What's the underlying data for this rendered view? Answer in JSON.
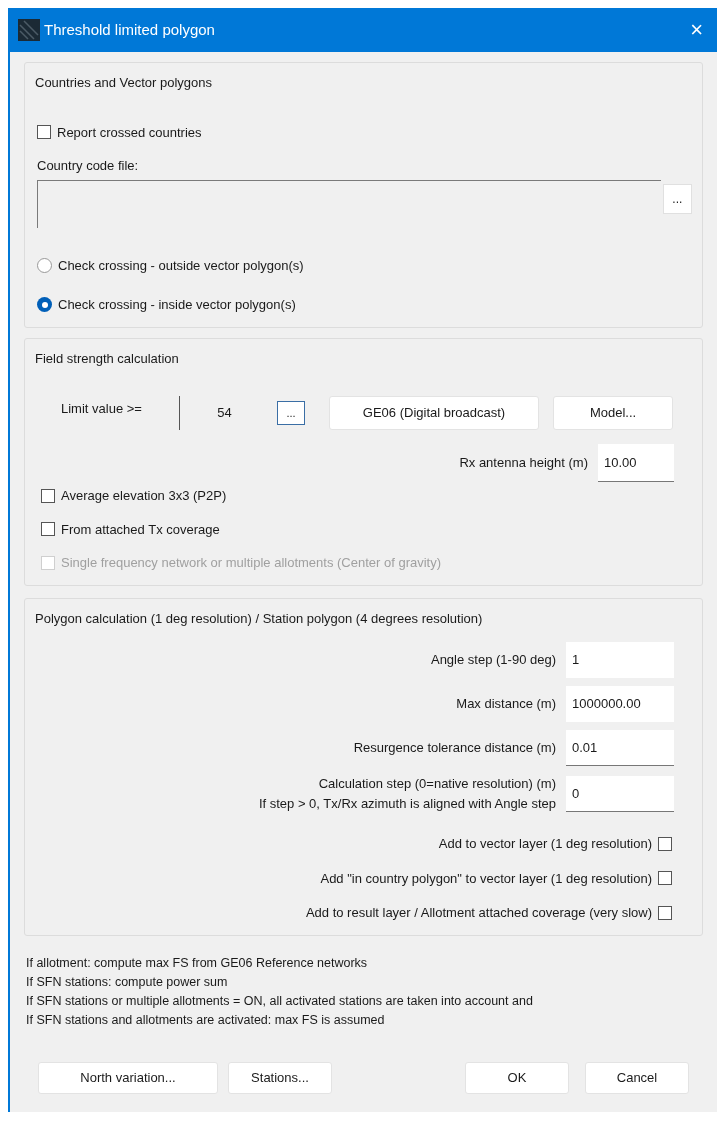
{
  "window": {
    "title": "Threshold limited polygon",
    "close": "×"
  },
  "countries_group": {
    "title": "Countries and Vector polygons",
    "report_checkbox": {
      "label": "Report crossed countries",
      "checked": false
    },
    "country_code_file": {
      "label": "Country code file:",
      "browse": "..."
    },
    "crossing_options": [
      {
        "label": "Check crossing - outside vector polygon(s)",
        "selected": false
      },
      {
        "label": "Check crossing - inside vector polygon(s)",
        "selected": true
      }
    ]
  },
  "field_strength_group": {
    "title": "Field strength calculation",
    "limit_label": "Limit value >=",
    "limit_value": "54",
    "limit_browse": "...",
    "buttons": [
      "GE06 (Digital broadcast)",
      "Model..."
    ],
    "rx_label": "Rx antenna height (m)",
    "rx_value": "10.00",
    "checkboxes": [
      {
        "label": "Average elevation 3x3 (P2P)",
        "checked": false,
        "disabled": false
      },
      {
        "label": "From attached Tx coverage",
        "checked": false,
        "disabled": false
      },
      {
        "label": "Single frequency network or multiple allotments (Center of gravity)",
        "checked": false,
        "disabled": true
      }
    ]
  },
  "polygon_group": {
    "title": "Polygon calculation (1 deg resolution) / Station polygon (4 degrees resolution)",
    "fields": [
      {
        "label": "Angle step (1-90 deg)",
        "value": "1"
      },
      {
        "label": "Max distance (m)",
        "value": "1000000.00"
      },
      {
        "label": "Resurgence tolerance distance (m)",
        "value": "0.01"
      },
      {
        "label": "Calculation step (0=native resolution) (m)",
        "note": "If step > 0, Tx/Rx azimuth is aligned with Angle step",
        "value": "0"
      }
    ],
    "checkboxes": [
      {
        "label": "Add to vector layer (1 deg resolution)",
        "checked": false
      },
      {
        "label": "Add \"in country polygon\" to vector layer (1 deg resolution)",
        "checked": false
      },
      {
        "label": "Add to result layer / Allotment attached coverage (very slow)",
        "checked": false
      }
    ]
  },
  "notes": [
    "If allotment: compute max FS from GE06 Reference networks",
    "If SFN stations: compute power sum",
    "If SFN stations or multiple allotments = ON, all activated stations are taken into account and",
    "If SFN stations and allotments are activated: max FS is assumed"
  ],
  "left_buttons": [
    "North variation...",
    "Stations..."
  ],
  "right_buttons": [
    "OK",
    "Cancel"
  ]
}
